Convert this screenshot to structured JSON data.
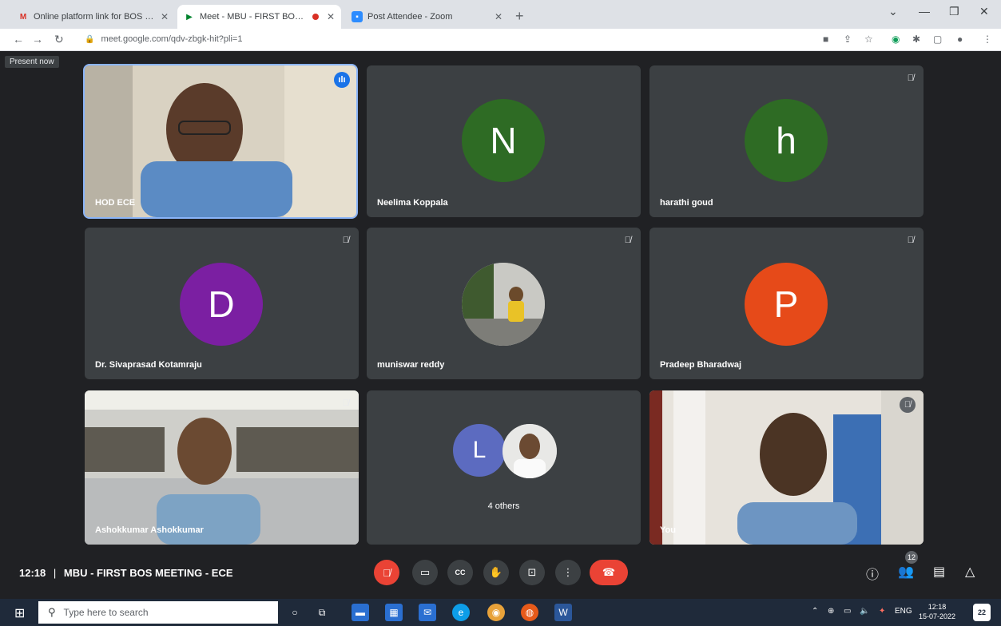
{
  "browser": {
    "tabs": [
      {
        "title": "Online platform link for BOS Mee",
        "favicon": "gmail-icon",
        "active": false
      },
      {
        "title": "Meet - MBU - FIRST BOS ME",
        "favicon": "meet-icon",
        "active": true
      },
      {
        "title": "Post Attendee - Zoom",
        "favicon": "zoom-icon",
        "active": false
      }
    ],
    "url": "meet.google.com/qdv-zbgk-hit?pli=1"
  },
  "meet": {
    "present_now_label": "Present now",
    "tiles": [
      {
        "name": "HOD ECE",
        "type": "video",
        "speaking": true
      },
      {
        "name": "Neelima Koppala",
        "type": "avatar",
        "initial": "N",
        "color": "#2e6b24",
        "muted": false
      },
      {
        "name": "harathi goud",
        "type": "avatar",
        "initial": "h",
        "color": "#2e6b24",
        "muted": true
      },
      {
        "name": "Dr. Sivaprasad Kotamraju",
        "type": "avatar",
        "initial": "D",
        "color": "#7b1fa2",
        "muted": true
      },
      {
        "name": "muniswar reddy",
        "type": "photo-avatar",
        "muted": true
      },
      {
        "name": "Pradeep Bharadwaj",
        "type": "avatar",
        "initial": "P",
        "color": "#e64a19",
        "muted": true
      },
      {
        "name": "Ashokkumar Ashokkumar",
        "type": "video",
        "muted": true
      },
      {
        "name": "4 others",
        "type": "group",
        "initial": "L",
        "color": "#5c6bc0"
      },
      {
        "name": "You",
        "type": "video",
        "muted": true
      }
    ],
    "bottom": {
      "time": "12:18",
      "separator": "|",
      "meeting_title": "MBU - FIRST BOS MEETING - ECE",
      "participant_count": "12"
    }
  },
  "taskbar": {
    "search_placeholder": "Type here to search",
    "language": "ENG",
    "time": "12:18",
    "date": "15-07-2022",
    "notifications": "22"
  }
}
